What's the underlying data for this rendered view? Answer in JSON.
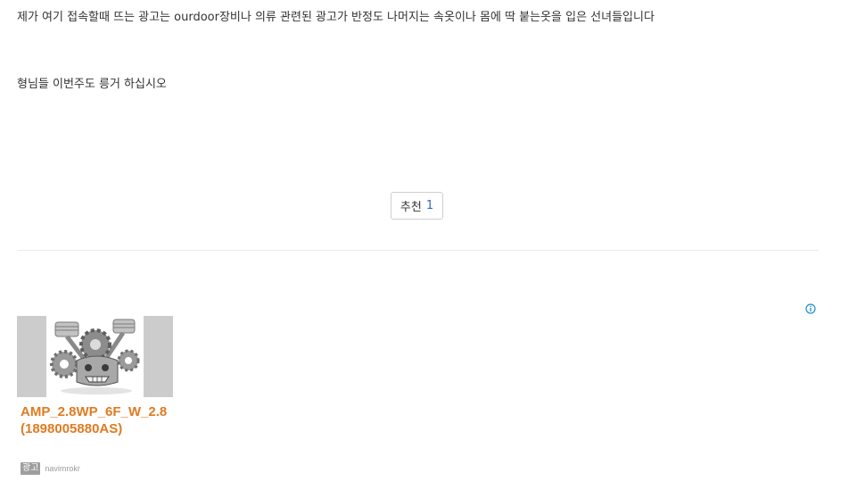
{
  "post": {
    "lines": [
      "제가 여기 접속할때 뜨는 광고는 ourdoor장비나 의류 관련된 광고가 반정도 나머지는 속옷이나 몸에 딱 붙는옷을 입은 선녀들입니다",
      "형님들 이번주도 릉거 하십시오"
    ]
  },
  "recommend": {
    "label": "추천",
    "count": "1"
  },
  "ad": {
    "title_line1": "AMP_2.8WP_6F_W_2.8",
    "title_line2": "(1898005880AS)",
    "badge": "광고",
    "source": "navimrokr",
    "image_icon": "engine-pistons-image",
    "info_icon": "info-circle-icon",
    "title_color": "#e07b22",
    "info_color": "#1a8ccf"
  }
}
